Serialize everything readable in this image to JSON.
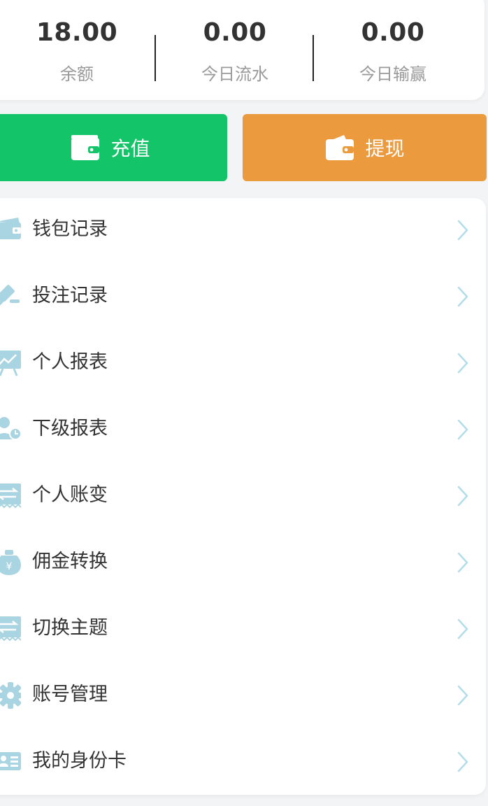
{
  "stats": [
    {
      "value": "18.00",
      "label": "余额"
    },
    {
      "value": "0.00",
      "label": "今日流水"
    },
    {
      "value": "0.00",
      "label": "今日输赢"
    }
  ],
  "actions": {
    "recharge": {
      "label": "充值",
      "icon": "wallet-icon",
      "color": "#14c468"
    },
    "withdraw": {
      "label": "提现",
      "icon": "wallet-icon",
      "color": "#ec9a3e"
    }
  },
  "menu": [
    {
      "label": "钱包记录",
      "icon": "wallet-icon"
    },
    {
      "label": "投注记录",
      "icon": "gavel-icon"
    },
    {
      "label": "个人报表",
      "icon": "chart-board-icon"
    },
    {
      "label": "下级报表",
      "icon": "user-clock-icon"
    },
    {
      "label": "个人账变",
      "icon": "transfer-icon"
    },
    {
      "label": "佣金转换",
      "icon": "money-bag-icon"
    },
    {
      "label": "切换主题",
      "icon": "transfer-icon"
    },
    {
      "label": "账号管理",
      "icon": "gear-icon"
    },
    {
      "label": "我的身份卡",
      "icon": "id-card-icon"
    }
  ],
  "icon_color": "#a9d4e2",
  "chevron_color": "#b3dde8"
}
